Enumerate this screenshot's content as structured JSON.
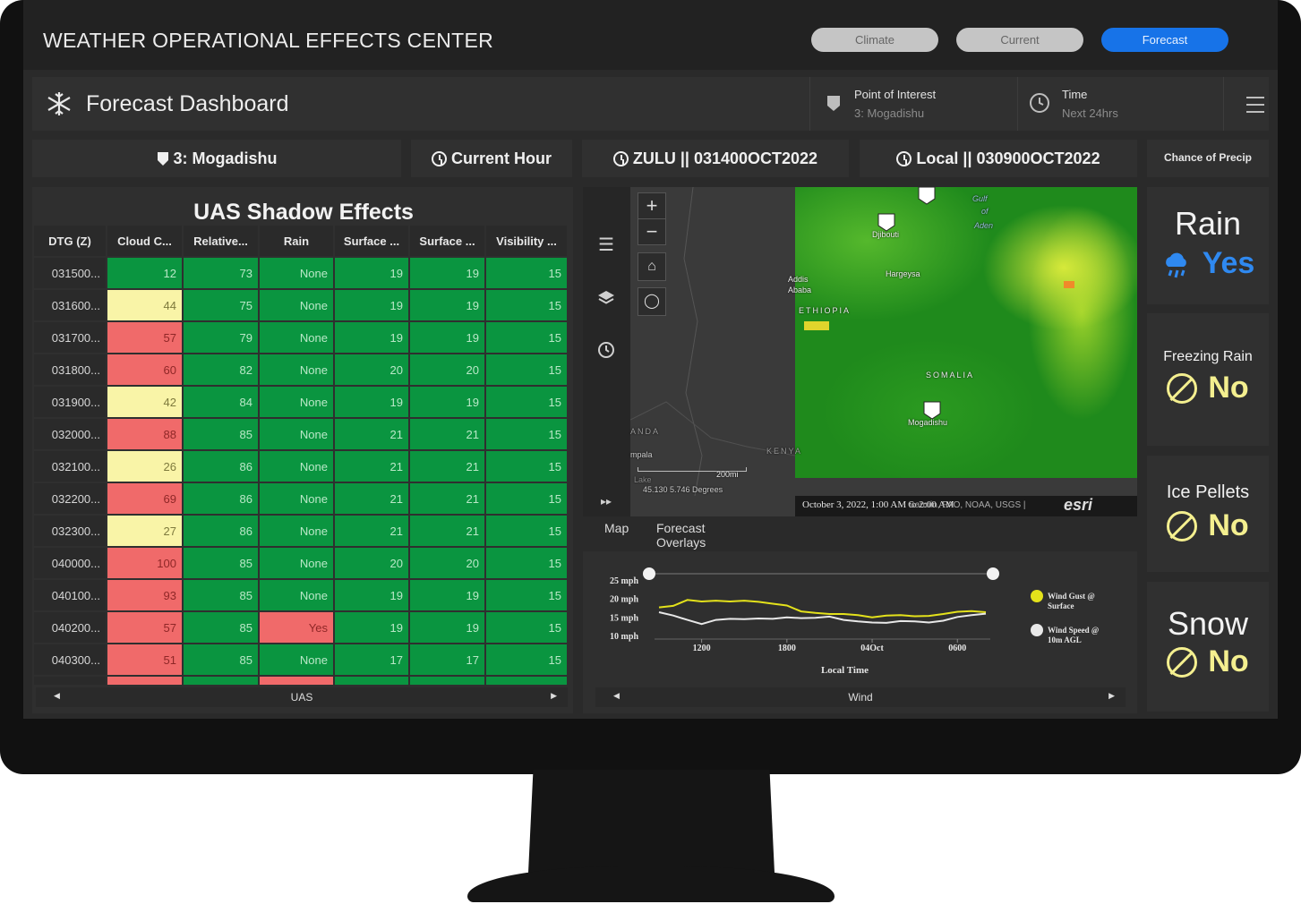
{
  "app": {
    "title": "WEATHER OPERATIONAL EFFECTS CENTER"
  },
  "nav": [
    {
      "label": "Climate",
      "style": "gray"
    },
    {
      "label": "Current",
      "style": "gray"
    },
    {
      "label": "Forecast",
      "style": "blue"
    }
  ],
  "header": {
    "title": "Forecast Dashboard",
    "poi_label": "Point of Interest",
    "poi_value": "3: Mogadishu",
    "time_label": "Time",
    "time_value": "Next 24hrs"
  },
  "info": {
    "location": "3: Mogadishu",
    "current": "Current Hour",
    "zulu": "ZULU || 031400OCT2022",
    "local": "Local || 030900OCT2022",
    "precip_header": "Chance of Precip"
  },
  "uas": {
    "title": "UAS Shadow Effects",
    "columns": [
      "DTG (Z)",
      "Cloud C...",
      "Relative...",
      "Rain",
      "Surface ...",
      "Surface ...",
      "Visibility ..."
    ],
    "rows": [
      {
        "dtg": "031500...",
        "cloud": "12",
        "cloud_c": "g",
        "rh": "73",
        "rain": "None",
        "rain_c": "g",
        "s1": "19",
        "s2": "19",
        "vis": "15"
      },
      {
        "dtg": "031600...",
        "cloud": "44",
        "cloud_c": "y",
        "rh": "75",
        "rain": "None",
        "rain_c": "g",
        "s1": "19",
        "s2": "19",
        "vis": "15"
      },
      {
        "dtg": "031700...",
        "cloud": "57",
        "cloud_c": "r",
        "rh": "79",
        "rain": "None",
        "rain_c": "g",
        "s1": "19",
        "s2": "19",
        "vis": "15"
      },
      {
        "dtg": "031800...",
        "cloud": "60",
        "cloud_c": "r",
        "rh": "82",
        "rain": "None",
        "rain_c": "g",
        "s1": "20",
        "s2": "20",
        "vis": "15"
      },
      {
        "dtg": "031900...",
        "cloud": "42",
        "cloud_c": "y",
        "rh": "84",
        "rain": "None",
        "rain_c": "g",
        "s1": "19",
        "s2": "19",
        "vis": "15"
      },
      {
        "dtg": "032000...",
        "cloud": "88",
        "cloud_c": "r",
        "rh": "85",
        "rain": "None",
        "rain_c": "g",
        "s1": "21",
        "s2": "21",
        "vis": "15"
      },
      {
        "dtg": "032100...",
        "cloud": "26",
        "cloud_c": "y",
        "rh": "86",
        "rain": "None",
        "rain_c": "g",
        "s1": "21",
        "s2": "21",
        "vis": "15"
      },
      {
        "dtg": "032200...",
        "cloud": "69",
        "cloud_c": "r",
        "rh": "86",
        "rain": "None",
        "rain_c": "g",
        "s1": "21",
        "s2": "21",
        "vis": "15"
      },
      {
        "dtg": "032300...",
        "cloud": "27",
        "cloud_c": "y",
        "rh": "86",
        "rain": "None",
        "rain_c": "g",
        "s1": "21",
        "s2": "21",
        "vis": "15"
      },
      {
        "dtg": "040000...",
        "cloud": "100",
        "cloud_c": "r",
        "rh": "85",
        "rain": "None",
        "rain_c": "g",
        "s1": "20",
        "s2": "20",
        "vis": "15"
      },
      {
        "dtg": "040100...",
        "cloud": "93",
        "cloud_c": "r",
        "rh": "85",
        "rain": "None",
        "rain_c": "g",
        "s1": "19",
        "s2": "19",
        "vis": "15"
      },
      {
        "dtg": "040200...",
        "cloud": "57",
        "cloud_c": "r",
        "rh": "85",
        "rain": "Yes",
        "rain_c": "r",
        "s1": "19",
        "s2": "19",
        "vis": "15"
      },
      {
        "dtg": "040300...",
        "cloud": "51",
        "cloud_c": "r",
        "rh": "85",
        "rain": "None",
        "rain_c": "g",
        "s1": "17",
        "s2": "17",
        "vis": "15"
      },
      {
        "dtg": "",
        "cloud": "",
        "cloud_c": "r",
        "rh": "",
        "rain": "",
        "rain_c": "r",
        "s1": "",
        "s2": "",
        "vis": ""
      }
    ],
    "scroll_label": "UAS"
  },
  "map": {
    "labels": [
      "Gulf",
      "of",
      "Aden",
      "Djibouti",
      "Hargeysa",
      "Addis",
      "Ababa",
      "ETHIOPIA",
      "SOMALIA",
      "Mogadishu",
      "ANDA",
      "KENYA",
      "mpala",
      "Lake"
    ],
    "coords": "45.130 5.746 Degrees",
    "time_range": "October 3, 2022, 1:00 AM to 2:00 AM",
    "attribution": "Garmin, FAO, NOAA, USGS |",
    "esri": "esri",
    "scale": "200mi",
    "tabs": [
      "Map",
      "Forecast Overlays"
    ]
  },
  "chart_data": {
    "type": "line",
    "xlabel": "Local Time",
    "x_ticks": [
      "1200",
      "1800",
      "04Oct",
      "0600"
    ],
    "y_ticks": [
      "10 mph",
      "15 mph",
      "20 mph",
      "25 mph"
    ],
    "ylim": [
      10,
      25
    ],
    "series": [
      {
        "name": "Wind Gust @ Surface",
        "color": "#e4e21b",
        "values": [
          17.6,
          18.0,
          19.6,
          19.2,
          19.4,
          19.2,
          19.4,
          19.1,
          18.6,
          18.1,
          16.5,
          16.1,
          15.8,
          15.8,
          15.5,
          14.9,
          15.4,
          15.5,
          15.2,
          15.3,
          15.8,
          16.4,
          16.6,
          16.3
        ]
      },
      {
        "name": "Wind Speed @ 10m AGL",
        "color": "#e8e8e8",
        "values": [
          16.3,
          15.4,
          14.2,
          13.1,
          14.2,
          14.5,
          14.4,
          14.6,
          14.5,
          14.9,
          14.7,
          14.8,
          15.1,
          14.2,
          13.8,
          13.5,
          13.4,
          13.9,
          13.8,
          13.5,
          14.0,
          15.0,
          15.5,
          15.9
        ]
      }
    ],
    "scroll_label": "Wind"
  },
  "precip": [
    {
      "name": "Rain",
      "value": "Yes",
      "icon": "rain-cloud-icon"
    },
    {
      "name": "Freezing Rain",
      "value": "No",
      "icon": "none-icon"
    },
    {
      "name": "Ice Pellets",
      "value": "No",
      "icon": "none-icon"
    },
    {
      "name": "Snow",
      "value": "No",
      "icon": "none-icon"
    }
  ]
}
